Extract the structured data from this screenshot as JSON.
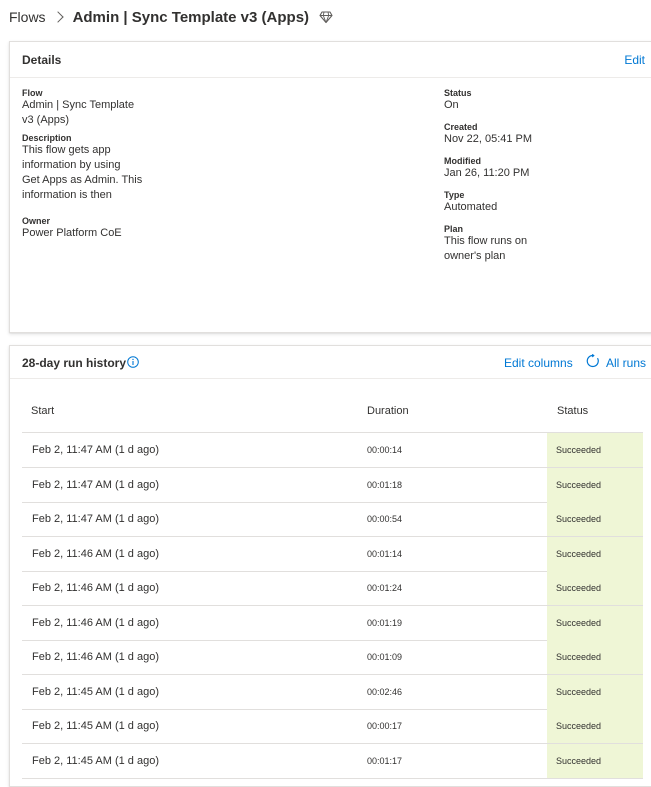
{
  "breadcrumb": {
    "root": "Flows",
    "title": "Admin | Sync Template v3 (Apps)"
  },
  "details": {
    "heading": "Details",
    "edit": "Edit",
    "flow_label": "Flow",
    "flow_line1": "Admin | Sync Template",
    "flow_line2": "v3 (Apps)",
    "description_label": "Description",
    "description_line1": "This flow gets app",
    "description_line2": "information by using",
    "description_line3": "Get Apps as Admin. This",
    "description_line4": "information is then",
    "owner_label": "Owner",
    "owner": "Power Platform CoE",
    "status_label": "Status",
    "status": "On",
    "created_label": "Created",
    "created": "Nov 22, 05:41 PM",
    "modified_label": "Modified",
    "modified": "Jan 26, 11:20 PM",
    "type_label": "Type",
    "type": "Automated",
    "plan_label": "Plan",
    "plan_line1": "This flow runs on",
    "plan_line2": "owner's plan"
  },
  "history": {
    "heading": "28-day run history",
    "edit_columns": "Edit columns",
    "all_runs": "All runs",
    "columns": {
      "start": "Start",
      "duration": "Duration",
      "status": "Status"
    },
    "rows": [
      {
        "start": "Feb 2, 11:47 AM (1 d ago)",
        "duration": "00:00:14",
        "status": "Succeeded"
      },
      {
        "start": "Feb 2, 11:47 AM (1 d ago)",
        "duration": "00:01:18",
        "status": "Succeeded"
      },
      {
        "start": "Feb 2, 11:47 AM (1 d ago)",
        "duration": "00:00:54",
        "status": "Succeeded"
      },
      {
        "start": "Feb 2, 11:46 AM (1 d ago)",
        "duration": "00:01:14",
        "status": "Succeeded"
      },
      {
        "start": "Feb 2, 11:46 AM (1 d ago)",
        "duration": "00:01:24",
        "status": "Succeeded"
      },
      {
        "start": "Feb 2, 11:46 AM (1 d ago)",
        "duration": "00:01:19",
        "status": "Succeeded"
      },
      {
        "start": "Feb 2, 11:46 AM (1 d ago)",
        "duration": "00:01:09",
        "status": "Succeeded"
      },
      {
        "start": "Feb 2, 11:45 AM (1 d ago)",
        "duration": "00:02:46",
        "status": "Succeeded"
      },
      {
        "start": "Feb 2, 11:45 AM (1 d ago)",
        "duration": "00:00:17",
        "status": "Succeeded"
      },
      {
        "start": "Feb 2, 11:45 AM (1 d ago)",
        "duration": "00:01:17",
        "status": "Succeeded"
      }
    ]
  },
  "colors": {
    "accent": "#0078d4",
    "success_cell": "#eff6d6",
    "text": "#323130"
  },
  "icons": {
    "breadcrumb_separator": "chevron-right-icon",
    "premium": "diamond-icon",
    "info": "info-icon",
    "refresh": "refresh-icon"
  }
}
